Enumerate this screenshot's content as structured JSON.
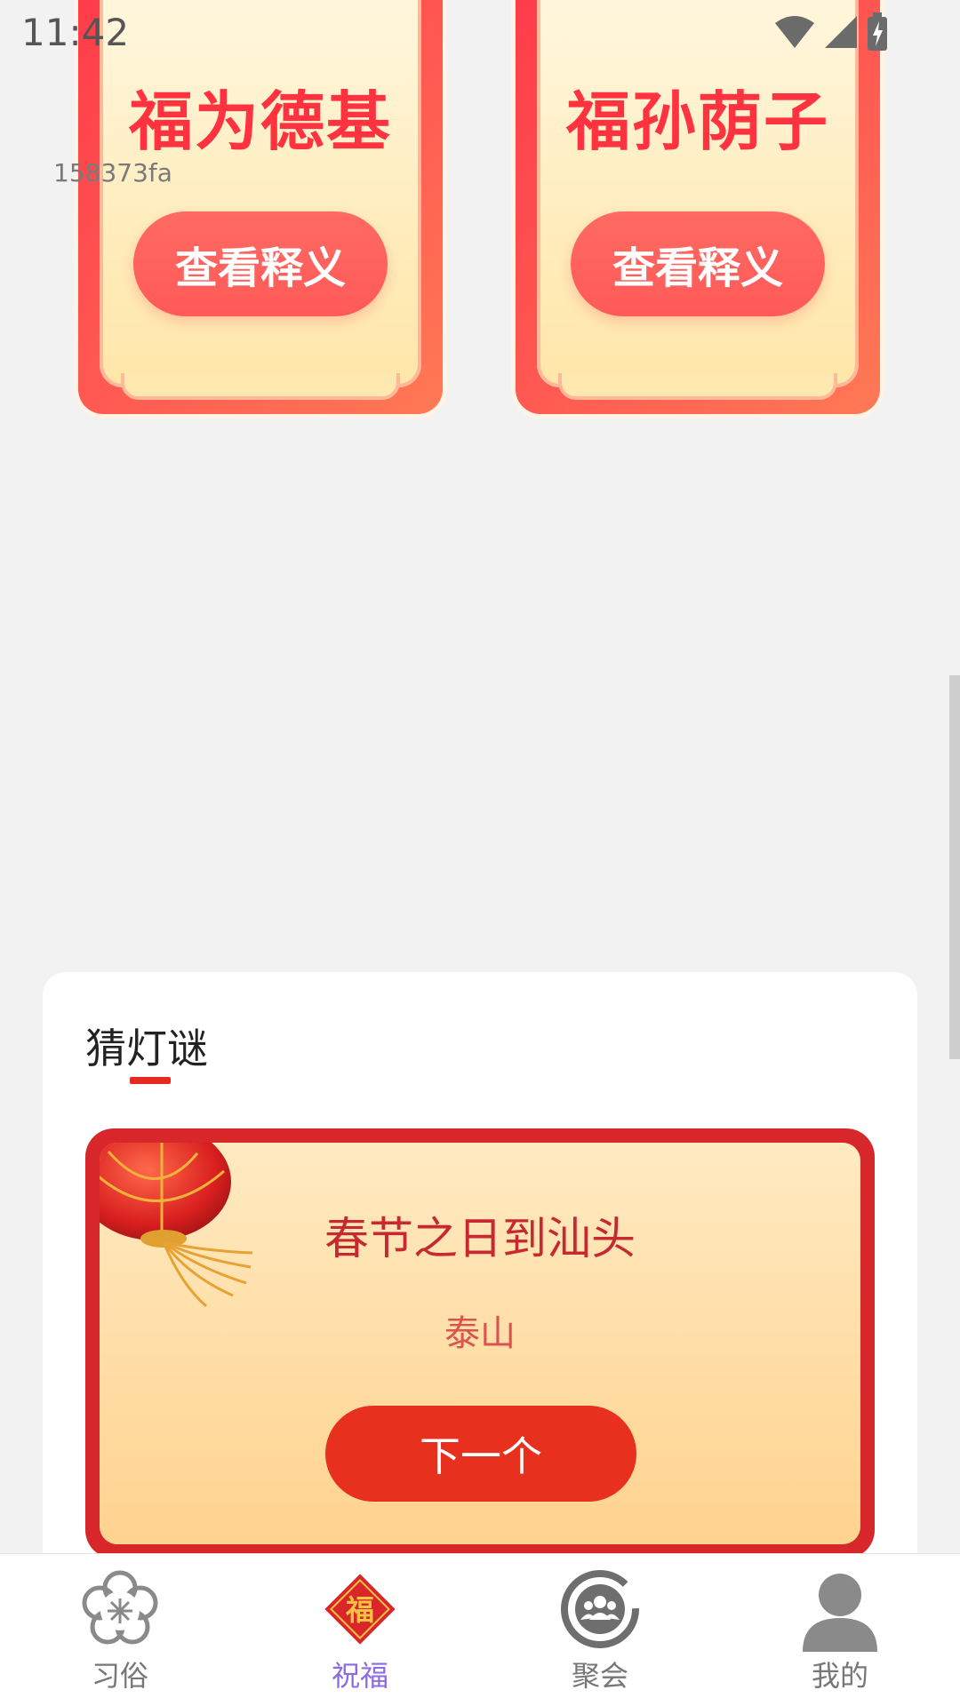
{
  "status_bar": {
    "time": "11:42"
  },
  "debug_tag": "158373fa",
  "blessing_cards": [
    {
      "title": "福为德基",
      "button": "查看释义"
    },
    {
      "title": "福孙荫子",
      "button": "查看释义"
    }
  ],
  "riddle": {
    "section_title": "猜灯谜",
    "question": "春节之日到汕头",
    "answer": "泰山",
    "next_button": "下一个"
  },
  "nav": {
    "items": [
      {
        "label": "习俗",
        "icon": "plum-blossom-icon"
      },
      {
        "label": "祝福",
        "icon": "fu-diamond-icon",
        "glyph": "福"
      },
      {
        "label": "聚会",
        "icon": "group-icon"
      },
      {
        "label": "我的",
        "icon": "person-icon"
      }
    ],
    "active_index": 1
  },
  "colors": {
    "accent_red": "#e8301f",
    "card_red": "#ff3b4a",
    "active_nav": "#8d6be0"
  }
}
